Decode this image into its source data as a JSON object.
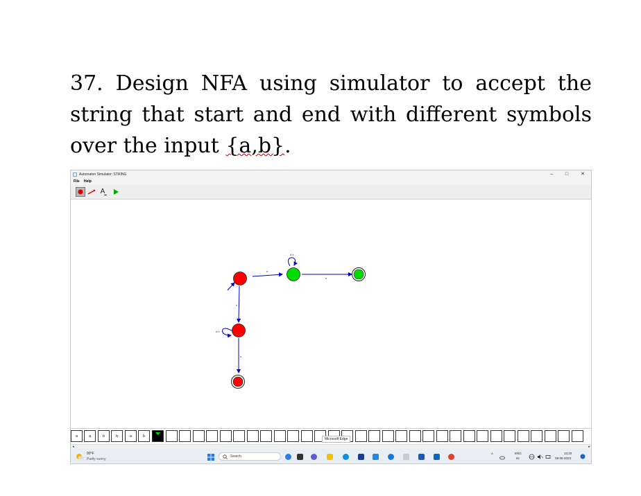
{
  "question": {
    "number": "37.",
    "text": "Design NFA using simulator to accept the string that start and end with different symbols over the input ",
    "underlined": "{a,b}",
    "end": "."
  },
  "window": {
    "title": "Automaton Simulator: STRING",
    "controls": {
      "minimize": "–",
      "maximize": "□",
      "close": "✕"
    },
    "menu": [
      "File",
      "Help"
    ]
  },
  "toolbar": {
    "tools": [
      "state-tool-icon",
      "transition-tool-icon",
      "text-tool-icon",
      "play-icon"
    ],
    "text_tool_label": "A"
  },
  "automaton": {
    "states": [
      {
        "id": "q0",
        "color": "#ff0000",
        "accepting": false
      },
      {
        "id": "q1",
        "color": "#00dd00",
        "accepting": false
      },
      {
        "id": "q2",
        "color": "#00dd00",
        "accepting": true
      },
      {
        "id": "q3",
        "color": "#ff0000",
        "accepting": false
      },
      {
        "id": "q4",
        "color": "#ff0000",
        "accepting": true
      }
    ],
    "transitions": [
      {
        "from": "q0",
        "to": "q1",
        "label": "a"
      },
      {
        "from": "q1",
        "to": "q1",
        "label": "a,b"
      },
      {
        "from": "q1",
        "to": "q2",
        "label": "b"
      },
      {
        "from": "q0",
        "to": "q3",
        "label": "b"
      },
      {
        "from": "q3",
        "to": "q3",
        "label": "a,b"
      },
      {
        "from": "q3",
        "to": "q4",
        "label": "a"
      }
    ],
    "colors": {
      "edge": "#0000cc",
      "label": "#444444"
    }
  },
  "tape": {
    "cells": [
      "a",
      "a",
      "b",
      "b",
      "a",
      "b"
    ],
    "total_cells": 38,
    "head_index": 6,
    "tooltip": "Microsoft Edge"
  },
  "taskbar": {
    "weather_temp": "90°F",
    "weather_desc": "Partly sunny",
    "search_label": "Search",
    "lang_top": "ENG",
    "lang_bottom": "IN",
    "time": "13:20",
    "date": "08-06-2023"
  }
}
